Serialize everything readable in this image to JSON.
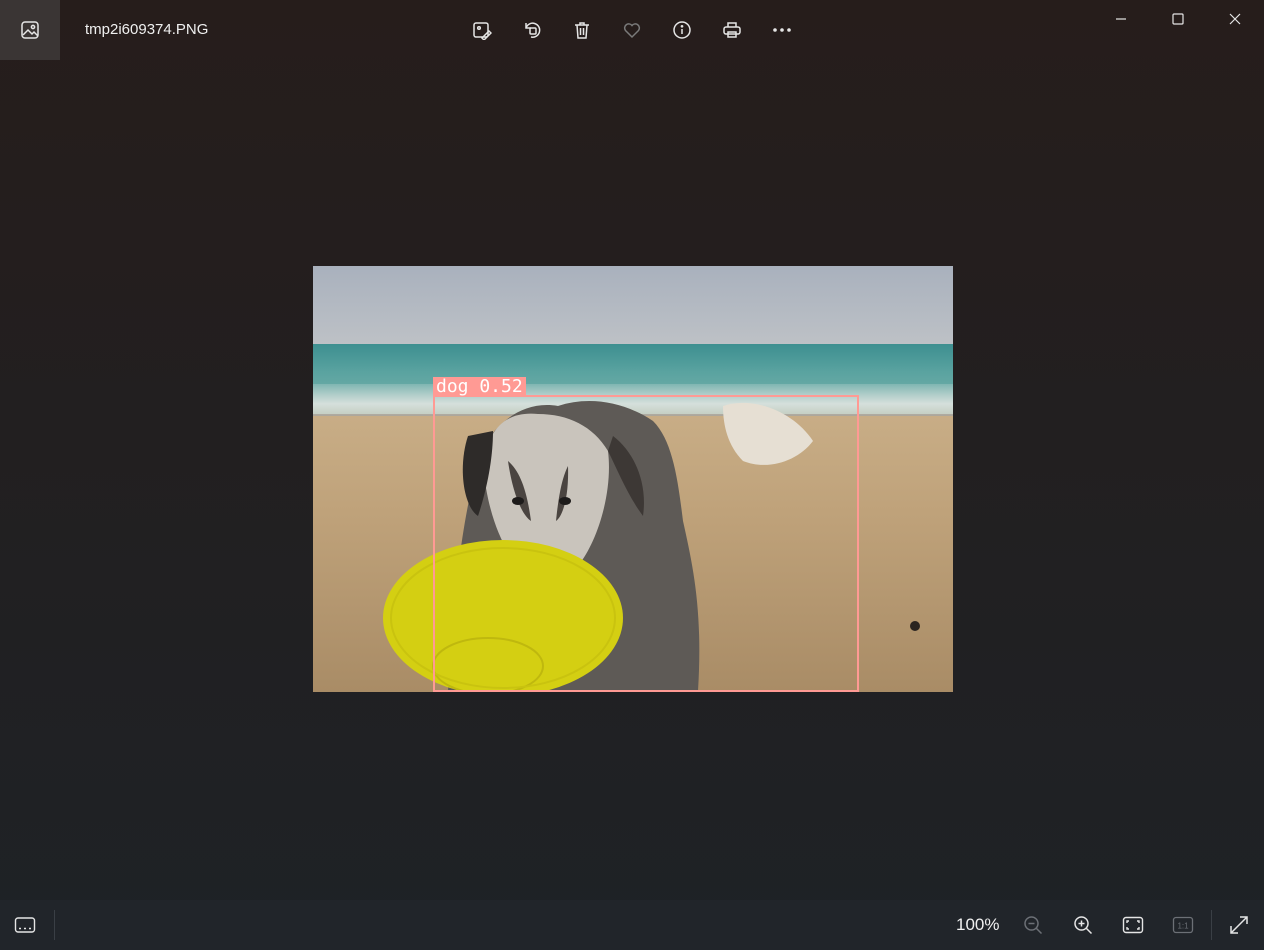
{
  "title_bar": {
    "file_name": "tmp2i609374.PNG",
    "toolbar": {
      "icons": [
        "edit-image-icon",
        "rotate-icon",
        "delete-icon",
        "favorite-icon",
        "info-icon",
        "print-icon",
        "more-icon"
      ]
    },
    "window_controls": [
      "minimize-icon",
      "maximize-icon",
      "close-icon"
    ]
  },
  "image": {
    "detections": [
      {
        "label": "dog 0.52",
        "color": "#ff9a94"
      }
    ]
  },
  "bottom_bar": {
    "zoom_level": "100%",
    "one_to_one_label": "1:1"
  }
}
